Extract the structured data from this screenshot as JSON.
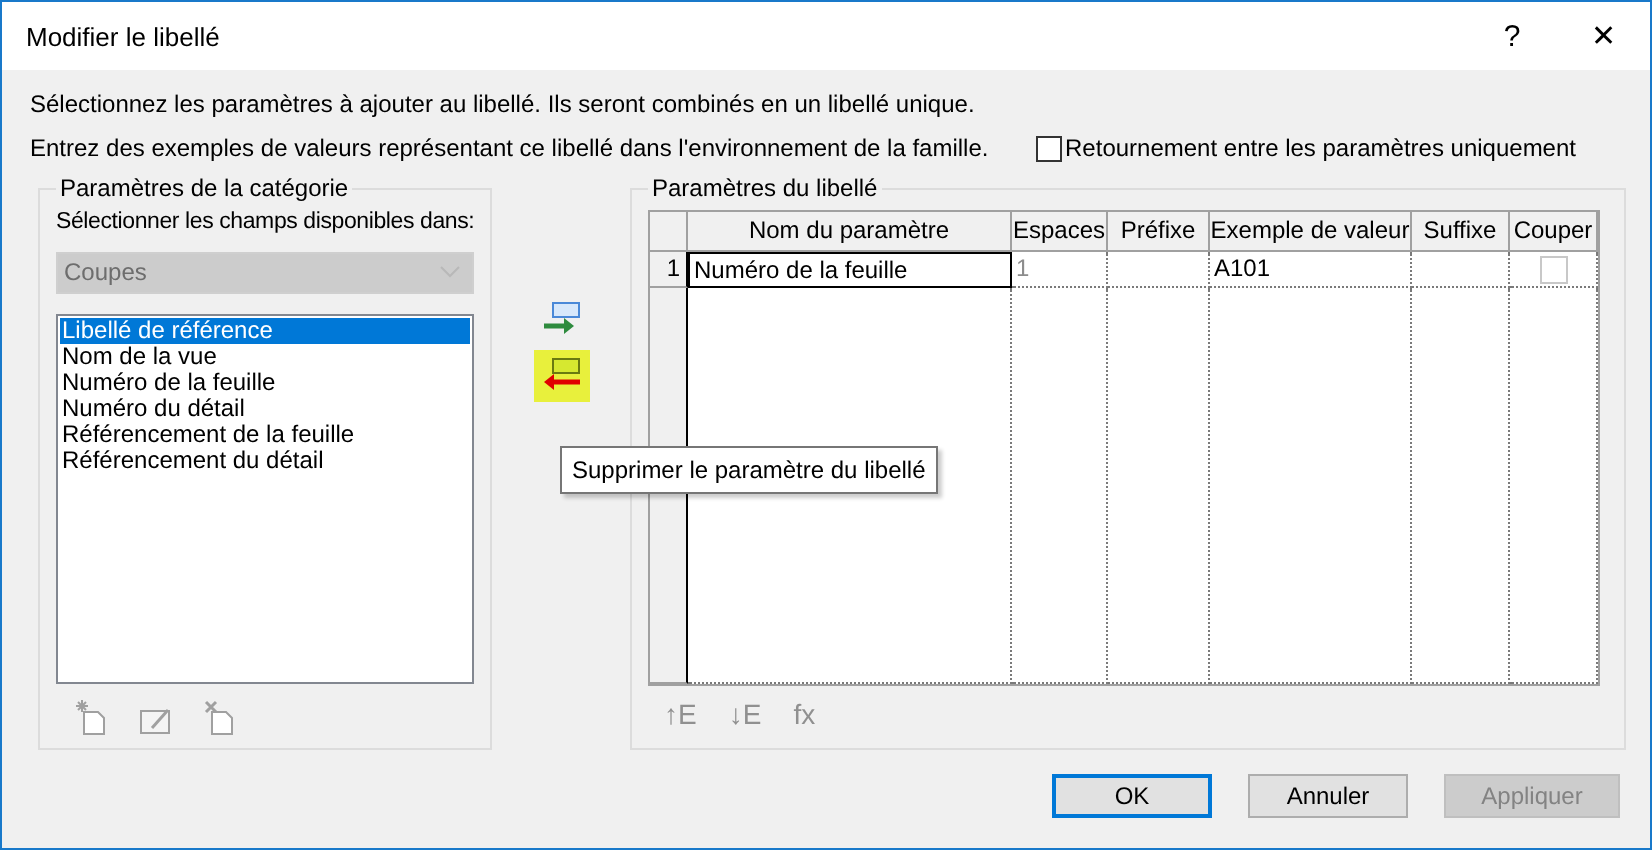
{
  "window": {
    "title": "Modifier le libellé",
    "help": "?",
    "close": "✕"
  },
  "instructions": [
    "Sélectionnez les paramètres à ajouter au libellé. Ils seront combinés en un libellé unique.",
    "Entrez des exemples de valeurs représentant ce libellé dans l'environnement de la famille."
  ],
  "wrap_option": {
    "label": "Retournement entre les paramètres uniquement",
    "checked": false
  },
  "category": {
    "title": "Paramètres de la catégorie",
    "prompt": "Sélectionner les champs disponibles dans:",
    "dropdown": {
      "value": "Coupes",
      "disabled": true
    },
    "fields": [
      {
        "label": "Libellé de référence",
        "selected": true
      },
      {
        "label": "Nom de la vue",
        "selected": false
      },
      {
        "label": "Numéro de la feuille",
        "selected": false
      },
      {
        "label": "Numéro du détail",
        "selected": false
      },
      {
        "label": "Référencement de la feuille",
        "selected": false
      },
      {
        "label": "Référencement du détail",
        "selected": false
      }
    ]
  },
  "tooltip": "Supprimer le paramètre du libellé",
  "label_params": {
    "title": "Paramètres du libellé",
    "columns": [
      "Nom du paramètre",
      "Espaces",
      "Préfixe",
      "Exemple de valeur",
      "Suffixe",
      "Couper"
    ],
    "rows": [
      {
        "number": "1",
        "name": "Numéro de la feuille",
        "spaces": "1",
        "prefix": "",
        "example": "A101",
        "suffix": "",
        "cut": false
      }
    ],
    "tools": [
      {
        "label": "↑E"
      },
      {
        "label": "↓E"
      },
      {
        "label": "fx"
      }
    ]
  },
  "buttons": [
    {
      "label": "OK",
      "default": true,
      "disabled": false
    },
    {
      "label": "Annuler",
      "default": false,
      "disabled": false
    },
    {
      "label": "Appliquer",
      "default": false,
      "disabled": true
    }
  ]
}
